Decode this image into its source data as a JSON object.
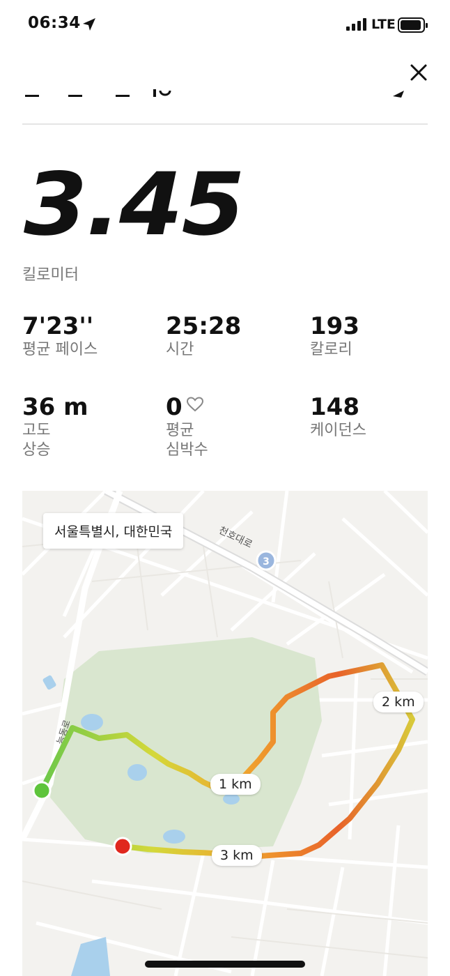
{
  "status_bar": {
    "time": "06:34",
    "network": "LTE"
  },
  "distance": {
    "value": "3.45",
    "unit": "킬로미터"
  },
  "stats": [
    {
      "value": "7'23''",
      "label": "평균 페이스"
    },
    {
      "value": "25:28",
      "label": "시간"
    },
    {
      "value": "193",
      "label": "칼로리"
    },
    {
      "value": "36 m",
      "label": "고도\n상승"
    },
    {
      "value": "0",
      "label": "평균\n심박수"
    },
    {
      "value": "148",
      "label": "케이던스"
    }
  ],
  "map": {
    "location": "서울특별시, 대한민국",
    "road_name": "천호대로",
    "road_name_2": "능동로",
    "route_badge": "3",
    "km_markers": [
      "1 km",
      "2 km",
      "3 km"
    ],
    "colors": {
      "park": "#d9e6cf",
      "water": "#a9d0ec",
      "start": "#5ec43b",
      "end": "#e0281e"
    }
  }
}
